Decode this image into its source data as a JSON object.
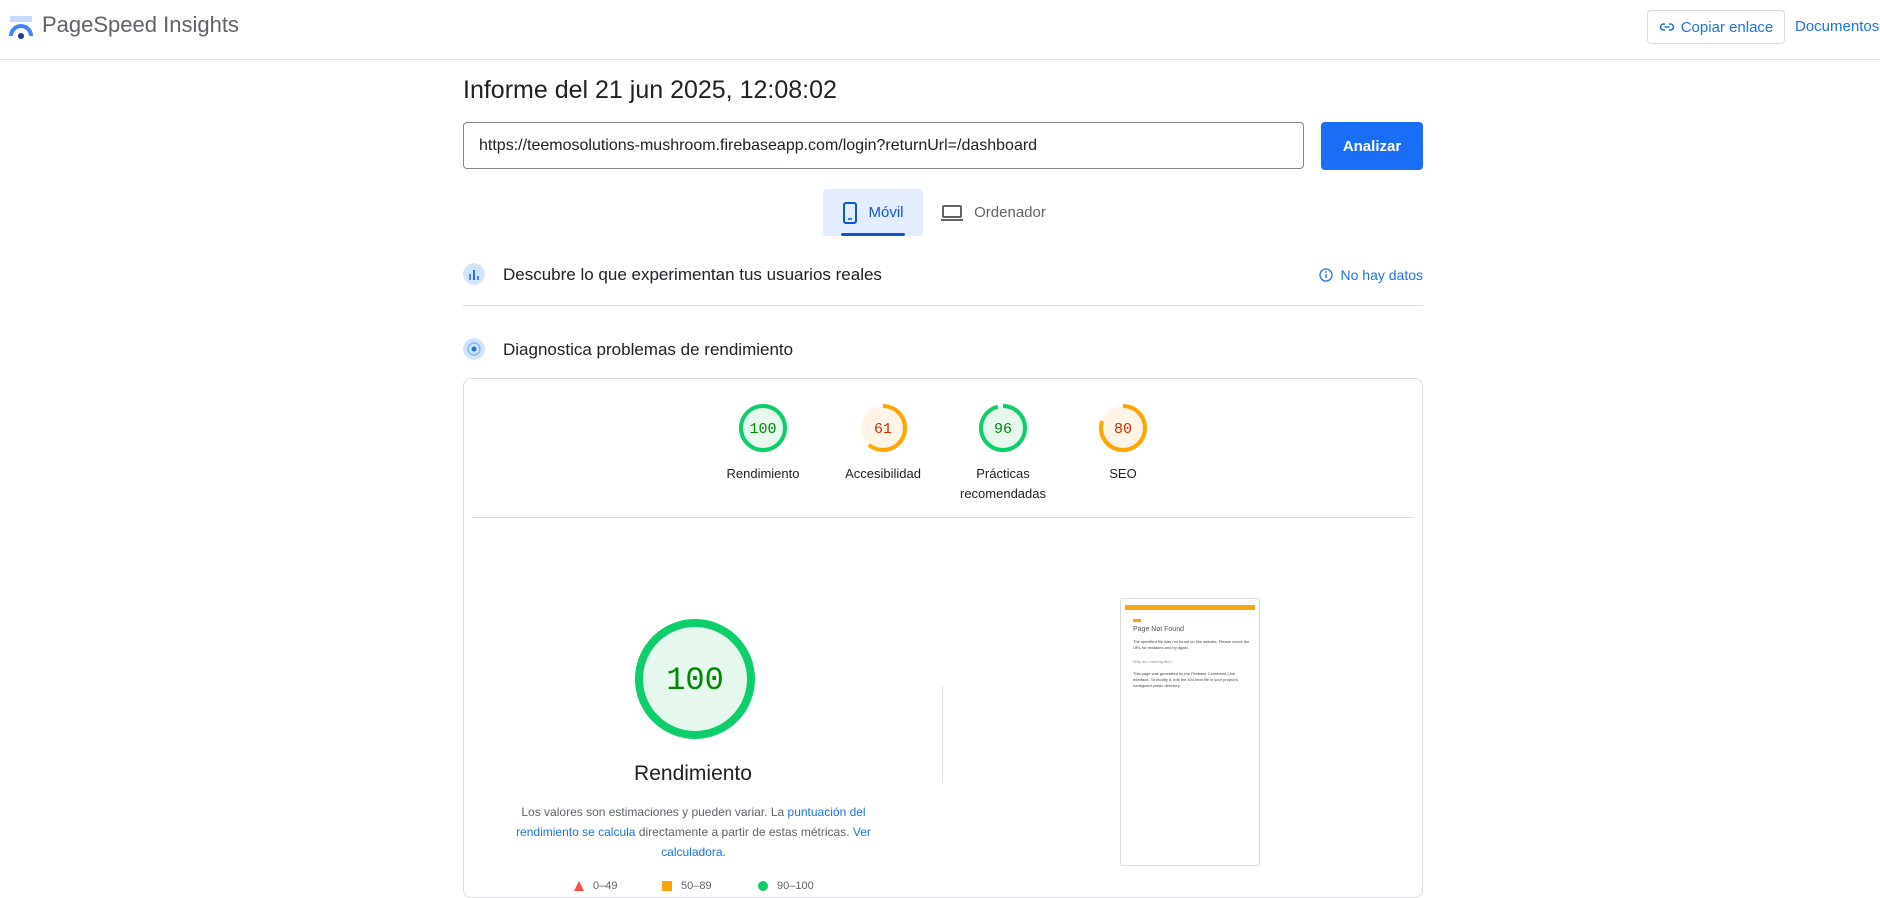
{
  "header": {
    "app_title": "PageSpeed Insights",
    "copy_link": "Copiar enlace",
    "docs": "Documentos"
  },
  "report": {
    "title": "Informe del 21 jun 2025, 12:08:02",
    "url": "https://teemosolutions-mushroom.firebaseapp.com/login?returnUrl=/dashboard",
    "analyze": "Analizar"
  },
  "tabs": {
    "mobile": "Móvil",
    "desktop": "Ordenador"
  },
  "field": {
    "title": "Descubre lo que experimentan tus usuarios reales",
    "no_data": "No hay datos"
  },
  "lab": {
    "title": "Diagnostica problemas de rendimiento"
  },
  "scores": [
    {
      "value": 100,
      "label_line1": "Rendimiento",
      "label_line2": "",
      "color": "#0cce6b",
      "fill": "#e6f8ee",
      "text": "#008800"
    },
    {
      "value": 61,
      "label_line1": "Accesibilidad",
      "label_line2": "",
      "color": "#ffa400",
      "fill": "#fff4e6",
      "text": "#c33300"
    },
    {
      "value": 96,
      "label_line1": "Prácticas",
      "label_line2": "recomendadas",
      "color": "#0cce6b",
      "fill": "#e6f8ee",
      "text": "#008800"
    },
    {
      "value": 80,
      "label_line1": "SEO",
      "label_line2": "",
      "color": "#ffa400",
      "fill": "#fff4e6",
      "text": "#c33300"
    }
  ],
  "main_score": {
    "value": 100,
    "label": "Rendimiento",
    "color": "#0cce6b"
  },
  "description": {
    "before": "Los valores son estimaciones y pueden variar. La ",
    "link1": "puntuación del rendimiento se calcula",
    "middle": " directamente a partir de estas métricas. ",
    "link2": "Ver calculadora."
  },
  "legend": [
    {
      "range": "0–49",
      "color": "#ff4e42"
    },
    {
      "range": "50–89",
      "color": "#ffa400"
    },
    {
      "range": "90–100",
      "color": "#0cce6b"
    }
  ],
  "thumbnail": {
    "heading": "Page Not Found",
    "body": "The specified file was not found on this website. Please check the URL for mistakes and try again.",
    "why": "Why am I seeing this?",
    "body2": "This page was generated by the Firebase Command-Line Interface. To modify it, edit the 404.html file in your project's configured public directory."
  }
}
